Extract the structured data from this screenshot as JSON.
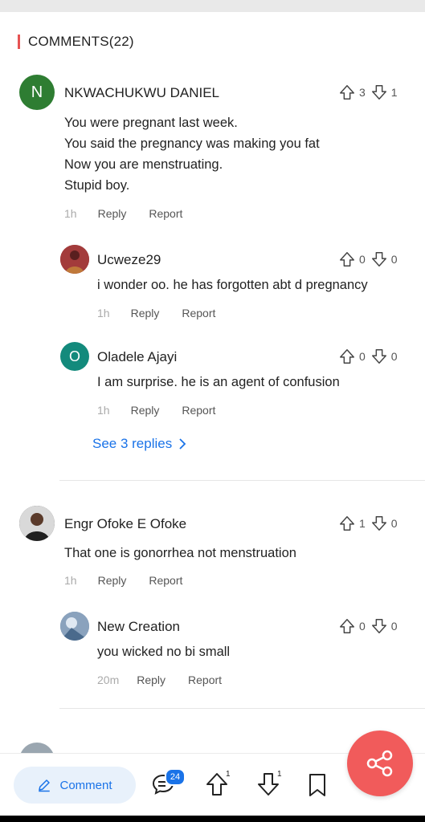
{
  "section": {
    "title": "COMMENTS(22)"
  },
  "comments": [
    {
      "avatar_letter": "N",
      "avatar_color": "#2e7d32",
      "name": "NKWACHUKWU DANIEL",
      "text": "You were pregnant last week.\nYou said the pregnancy was making you fat\nNow you are menstruating.\nStupid boy.",
      "time": "1h",
      "reply": "Reply",
      "report": "Report",
      "upvotes": "3",
      "downvotes": "1",
      "replies": [
        {
          "avatar_letter": "",
          "avatar_color": "#8a2a2a",
          "name": "Ucweze29",
          "text": "i wonder oo. he has forgotten abt d pregnancy",
          "time": "1h",
          "reply": "Reply",
          "report": "Report",
          "upvotes": "0",
          "downvotes": "0"
        },
        {
          "avatar_letter": "O",
          "avatar_color": "#138a7c",
          "name": "Oladele Ajayi",
          "text": "I am surprise. he is an agent of confusion",
          "time": "1h",
          "reply": "Reply",
          "report": "Report",
          "upvotes": "0",
          "downvotes": "0"
        }
      ],
      "see_replies": "See 3 replies"
    },
    {
      "avatar_letter": "",
      "avatar_color": "#3b3b3b",
      "name": "Engr Ofoke E Ofoke",
      "text": "That one is gonorrhea not menstruation",
      "time": "1h",
      "reply": "Reply",
      "report": "Report",
      "upvotes": "1",
      "downvotes": "0",
      "replies": [
        {
          "avatar_letter": "",
          "avatar_color": "#6d8aa8",
          "name": "New Creation",
          "text": "you wicked  no bi small",
          "time": "20m",
          "reply": "Reply",
          "report": "Report",
          "upvotes": "0",
          "downvotes": "0"
        }
      ]
    }
  ],
  "bottom_bar": {
    "comment_label": "Comment",
    "comment_count_badge": "24",
    "upvote_count": "1",
    "downvote_count": "1",
    "icons": [
      "pencil-icon",
      "chat-bubble-icon",
      "arrow-up-icon",
      "arrow-down-icon",
      "bookmark-icon",
      "share-icon"
    ]
  },
  "colors": {
    "accent": "#1a73e8",
    "share_fab": "#f15b5b",
    "section_marker": "#e65353"
  }
}
